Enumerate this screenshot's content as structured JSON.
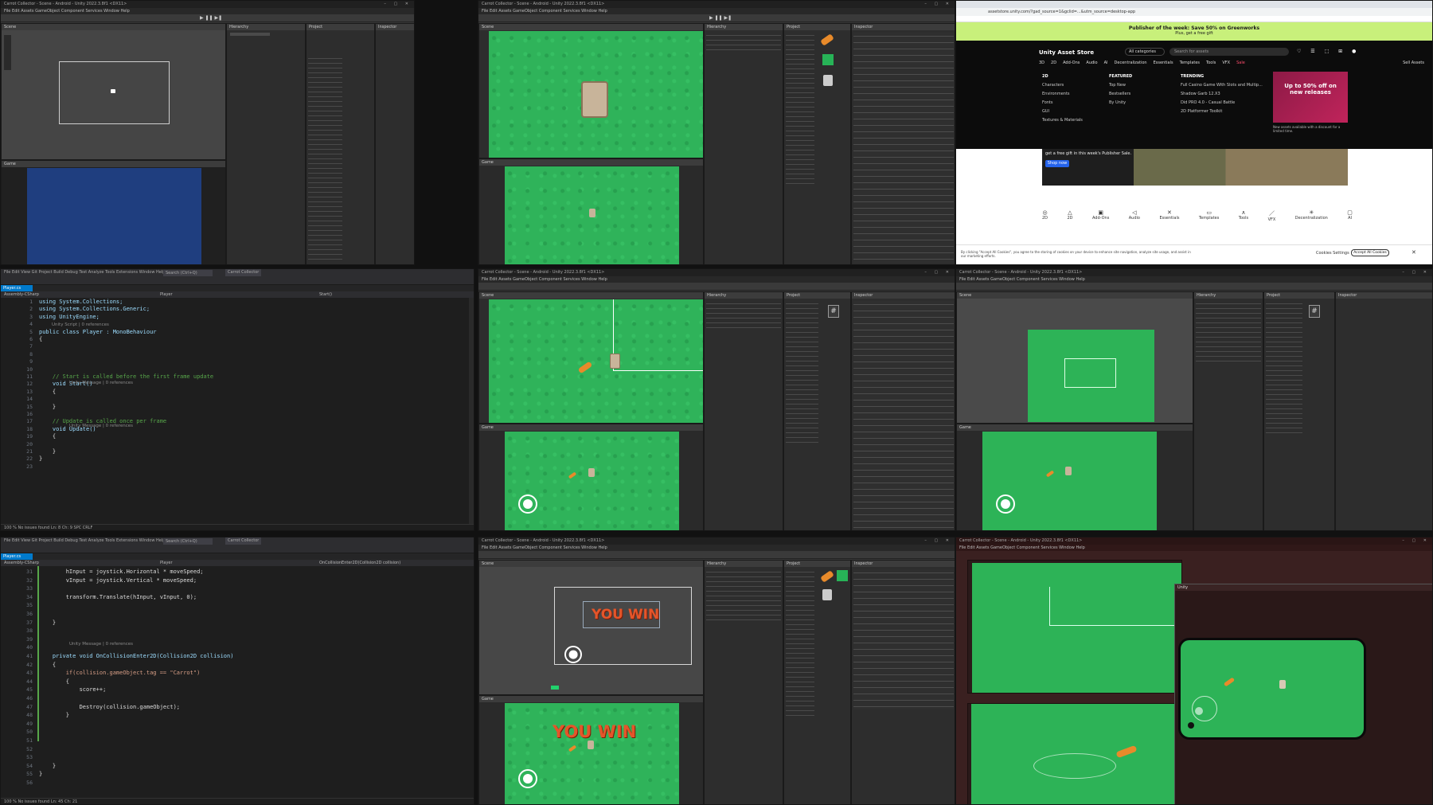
{
  "tile_tl": {
    "window_title": "Carrot Collector - Scene - Android - Unity 2022.3.8f1 <DX11>",
    "menu": "File  Edit  Assets  GameObject  Component  Services  Window  Help",
    "hierarchy_tab": "Hierarchy",
    "project_tab": "Project",
    "inspector_tab": "Inspector",
    "scene_label": "Scene",
    "game_label": "Game"
  },
  "tile_tm": {
    "window_title": "Carrot Collector - Scene - Android - Unity 2022.3.8f1 <DX11>",
    "menu": "File  Edit  Assets  GameObject  Component  Services  Window  Help",
    "hierarchy_tab": "Hierarchy",
    "project_tab": "Project",
    "inspector_tab": "Inspector"
  },
  "browser": {
    "url": "assetstore.unity.com/?gad_source=1&gclid=...&utm_source=desktop-app",
    "banner_title": "Publisher of the week: Save 50% on Greenworks",
    "banner_sub": "Plus, get a free gift",
    "logo": "Unity Asset Store",
    "category_select": "All categories",
    "search_placeholder": "Search for assets",
    "nav": [
      "3D",
      "2D",
      "Add-Ons",
      "Audio",
      "AI",
      "Decentralization",
      "Essentials",
      "Templates",
      "Tools",
      "VFX",
      "Sale"
    ],
    "sell_label": "Sell Assets",
    "mega_heads": [
      "2D",
      "FEATURED",
      "TRENDING"
    ],
    "mega_col1": [
      "Characters",
      "Environments",
      "Fonts",
      "GUI",
      "Textures & Materials"
    ],
    "mega_col2": [
      "Top New",
      "Bestsellers",
      "By Unity"
    ],
    "mega_col3": [
      "Full Casino Game With Slots and Multip...",
      "Shadow Garb 12.X3",
      "Did PRO 4.0 - Casual Battle",
      "2D Platformer Toolkit"
    ],
    "promo": "Up to 50% off on new releases",
    "promo_sub": "New assets available with a discount for a limited time.",
    "gift_text": "get a free gift in this week's Publisher Sale.",
    "shop_btn": "Shop now",
    "cats": [
      "2D",
      "2D",
      "Add-Ons",
      "Audio",
      "Essentials",
      "Templates",
      "Tools",
      "VFX",
      "Decentralization",
      "AI"
    ],
    "cookie_text": "By clicking \"Accept All Cookies\", you agree to the storing of cookies on your device to enhance site navigation, analyze site usage, and assist in our marketing efforts.",
    "cookie_settings": "Cookies Settings",
    "cookie_accept": "Accept All Cookies"
  },
  "code1": {
    "menu": "File  Edit  View  Git  Project  Build  Debug  Test  Analyze  Tools  Extensions  Window  Help",
    "search": "Search (Ctrl+Q)",
    "solution": "Carrot Collector",
    "tab": "Player.cs",
    "nav_left": "Assembly-CSharp",
    "nav_mid": "Player",
    "nav_right": "Start()",
    "hint_line": "Unity Script | 0 references",
    "hint_msg": "Unity Message | 0 references",
    "lines": [
      {
        "n": "1",
        "t": "using System.Collections;"
      },
      {
        "n": "2",
        "t": "using System.Collections.Generic;"
      },
      {
        "n": "3",
        "t": "using UnityEngine;"
      },
      {
        "n": "4",
        "t": ""
      },
      {
        "n": "5",
        "t": "public class Player : MonoBehaviour"
      },
      {
        "n": "6",
        "t": "{"
      },
      {
        "n": "7",
        "t": ""
      },
      {
        "n": "8",
        "t": ""
      },
      {
        "n": "9",
        "t": ""
      },
      {
        "n": "10",
        "t": ""
      },
      {
        "n": "11",
        "t": "    // Start is called before the first frame update"
      },
      {
        "n": "12",
        "t": "    void Start()"
      },
      {
        "n": "13",
        "t": "    {"
      },
      {
        "n": "14",
        "t": ""
      },
      {
        "n": "15",
        "t": "    }"
      },
      {
        "n": "16",
        "t": ""
      },
      {
        "n": "17",
        "t": "    // Update is called once per frame"
      },
      {
        "n": "18",
        "t": "    void Update()"
      },
      {
        "n": "19",
        "t": "    {"
      },
      {
        "n": "20",
        "t": ""
      },
      {
        "n": "21",
        "t": "    }"
      },
      {
        "n": "22",
        "t": "}"
      },
      {
        "n": "23",
        "t": ""
      }
    ],
    "status": "100 %   No issues found   Ln: 8  Ch: 9  SPC  CRLF"
  },
  "code2": {
    "tab": "Player",
    "nav_right": "OnCollisionEnter2D(Collision2D collision)",
    "hint_msg": "Unity Message | 0 references",
    "lines": [
      {
        "n": "31",
        "t": "        hInput = joystick.Horizontal * moveSpeed;"
      },
      {
        "n": "32",
        "t": "        vInput = joystick.Vertical * moveSpeed;"
      },
      {
        "n": "33",
        "t": ""
      },
      {
        "n": "34",
        "t": "        transform.Translate(hInput, vInput, 0);"
      },
      {
        "n": "35",
        "t": ""
      },
      {
        "n": "36",
        "t": ""
      },
      {
        "n": "37",
        "t": "    }"
      },
      {
        "n": "38",
        "t": ""
      },
      {
        "n": "39",
        "t": ""
      },
      {
        "n": "40",
        "t": ""
      },
      {
        "n": "41",
        "t": "    private void OnCollisionEnter2D(Collision2D collision)"
      },
      {
        "n": "42",
        "t": "    {"
      },
      {
        "n": "43",
        "t": "        if(collision.gameObject.tag == \"Carrot\")"
      },
      {
        "n": "44",
        "t": "        {"
      },
      {
        "n": "45",
        "t": "            score++;"
      },
      {
        "n": "46",
        "t": ""
      },
      {
        "n": "47",
        "t": "            Destroy(collision.gameObject);"
      },
      {
        "n": "48",
        "t": "        }"
      },
      {
        "n": "49",
        "t": ""
      },
      {
        "n": "50",
        "t": ""
      },
      {
        "n": "51",
        "t": ""
      },
      {
        "n": "52",
        "t": ""
      },
      {
        "n": "53",
        "t": ""
      },
      {
        "n": "54",
        "t": "    }"
      },
      {
        "n": "55",
        "t": "}"
      },
      {
        "n": "56",
        "t": ""
      }
    ],
    "status": "100 %   No issues found   Ln: 45  Ch: 21"
  },
  "win_text": "YOU WIN",
  "build_dialog": {
    "title": "Unity"
  },
  "colors": {
    "grass": "#2db357",
    "unity_bg": "#383838",
    "code_bg": "#1e1e1e",
    "promo": "#c0245b",
    "win": "#e4552a"
  }
}
